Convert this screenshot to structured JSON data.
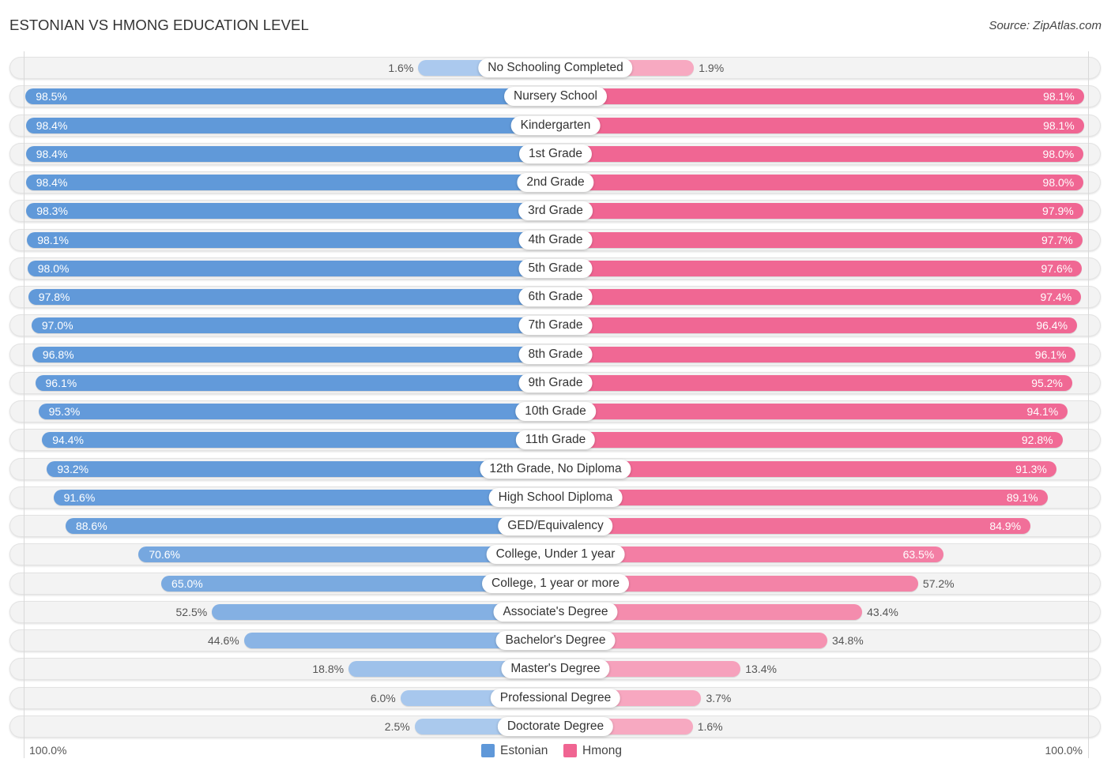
{
  "chart_data": {
    "type": "bar",
    "orientation": "horizontal-diverging",
    "title": "ESTONIAN VS HMONG EDUCATION LEVEL",
    "source": "Source: ZipAtlas.com",
    "xlabel": "",
    "ylabel": "",
    "xlim": [
      0,
      100
    ],
    "grid": false,
    "legend_position": "bottom-center",
    "axis_labels": {
      "left": "100.0%",
      "right": "100.0%"
    },
    "categories": [
      "No Schooling Completed",
      "Nursery School",
      "Kindergarten",
      "1st Grade",
      "2nd Grade",
      "3rd Grade",
      "4th Grade",
      "5th Grade",
      "6th Grade",
      "7th Grade",
      "8th Grade",
      "9th Grade",
      "10th Grade",
      "11th Grade",
      "12th Grade, No Diploma",
      "High School Diploma",
      "GED/Equivalency",
      "College, Under 1 year",
      "College, 1 year or more",
      "Associate's Degree",
      "Bachelor's Degree",
      "Master's Degree",
      "Professional Degree",
      "Doctorate Degree"
    ],
    "series": [
      {
        "name": "Estonian",
        "side": "left",
        "color": "#5f98d9",
        "color_light": "#accaee",
        "values": [
          1.6,
          98.5,
          98.4,
          98.4,
          98.4,
          98.3,
          98.1,
          98.0,
          97.8,
          97.0,
          96.8,
          96.1,
          95.3,
          94.4,
          93.2,
          91.6,
          88.6,
          70.6,
          65.0,
          52.5,
          44.6,
          18.8,
          6.0,
          2.5
        ],
        "value_labels": [
          "1.6%",
          "98.5%",
          "98.4%",
          "98.4%",
          "98.4%",
          "98.3%",
          "98.1%",
          "98.0%",
          "97.8%",
          "97.0%",
          "96.8%",
          "96.1%",
          "95.3%",
          "94.4%",
          "93.2%",
          "91.6%",
          "88.6%",
          "70.6%",
          "65.0%",
          "52.5%",
          "44.6%",
          "18.8%",
          "6.0%",
          "2.5%"
        ]
      },
      {
        "name": "Hmong",
        "side": "right",
        "color": "#f06592",
        "color_light": "#f7aac2",
        "values": [
          1.9,
          98.1,
          98.1,
          98.0,
          98.0,
          97.9,
          97.7,
          97.6,
          97.4,
          96.4,
          96.1,
          95.2,
          94.1,
          92.8,
          91.3,
          89.1,
          84.9,
          63.5,
          57.2,
          43.4,
          34.8,
          13.4,
          3.7,
          1.6
        ],
        "value_labels": [
          "1.9%",
          "98.1%",
          "98.1%",
          "98.0%",
          "98.0%",
          "97.9%",
          "97.7%",
          "97.6%",
          "97.4%",
          "96.4%",
          "96.1%",
          "95.2%",
          "94.1%",
          "92.8%",
          "91.3%",
          "89.1%",
          "84.9%",
          "63.5%",
          "57.2%",
          "43.4%",
          "34.8%",
          "13.4%",
          "3.7%",
          "1.6%"
        ]
      }
    ]
  }
}
